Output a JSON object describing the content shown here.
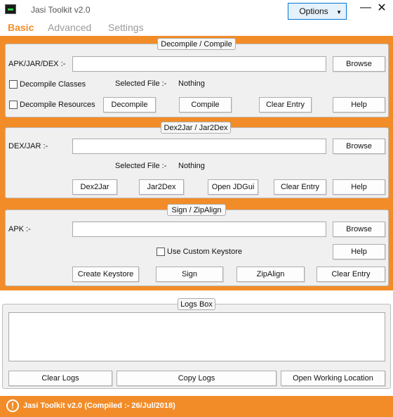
{
  "window": {
    "title": "Jasi Toolkit v2.0",
    "options_label": "Options",
    "minimize_glyph": "—",
    "close_glyph": "✕"
  },
  "tabs": [
    {
      "label": "Basic",
      "active": true
    },
    {
      "label": "Advanced",
      "active": false
    },
    {
      "label": "Settings",
      "active": false
    }
  ],
  "decompile": {
    "legend": "Decompile / Compile",
    "path_label": "APK/JAR/DEX :-",
    "path_value": "",
    "browse": "Browse",
    "cb_classes": "Decompile Classes",
    "cb_resources": "Decompile Resources",
    "selected_label": "Selected File :-",
    "selected_value": "Nothing",
    "btn_decompile": "Decompile",
    "btn_compile": "Compile",
    "btn_clear": "Clear Entry",
    "btn_help": "Help"
  },
  "dex2jar": {
    "legend": "Dex2Jar / Jar2Dex",
    "path_label": "DEX/JAR :-",
    "path_value": "",
    "browse": "Browse",
    "selected_label": "Selected File :-",
    "selected_value": "Nothing",
    "btn_dex2jar": "Dex2Jar",
    "btn_jar2dex": "Jar2Dex",
    "btn_jdgui": "Open JDGui",
    "btn_clear": "Clear Entry",
    "btn_help": "Help"
  },
  "sign": {
    "legend": "Sign / ZipAlign",
    "path_label": "APK :-",
    "path_value": "",
    "browse": "Browse",
    "cb_keystore": "Use Custom Keystore",
    "btn_help": "Help",
    "btn_create": "Create Keystore",
    "btn_sign": "Sign",
    "btn_zipalign": "ZipAlign",
    "btn_clear": "Clear Entry"
  },
  "logs": {
    "legend": "Logs Box",
    "content": "",
    "btn_clear": "Clear Logs",
    "btn_copy": "Copy Logs",
    "btn_open": "Open Working Location"
  },
  "status": {
    "icon": "!",
    "text": "Jasi Toolkit v2.0 (Compiled :- 26/Jul/2018)"
  },
  "colors": {
    "accent": "#f28c28",
    "panel": "#f0f0f0",
    "focus": "#0078d7"
  }
}
